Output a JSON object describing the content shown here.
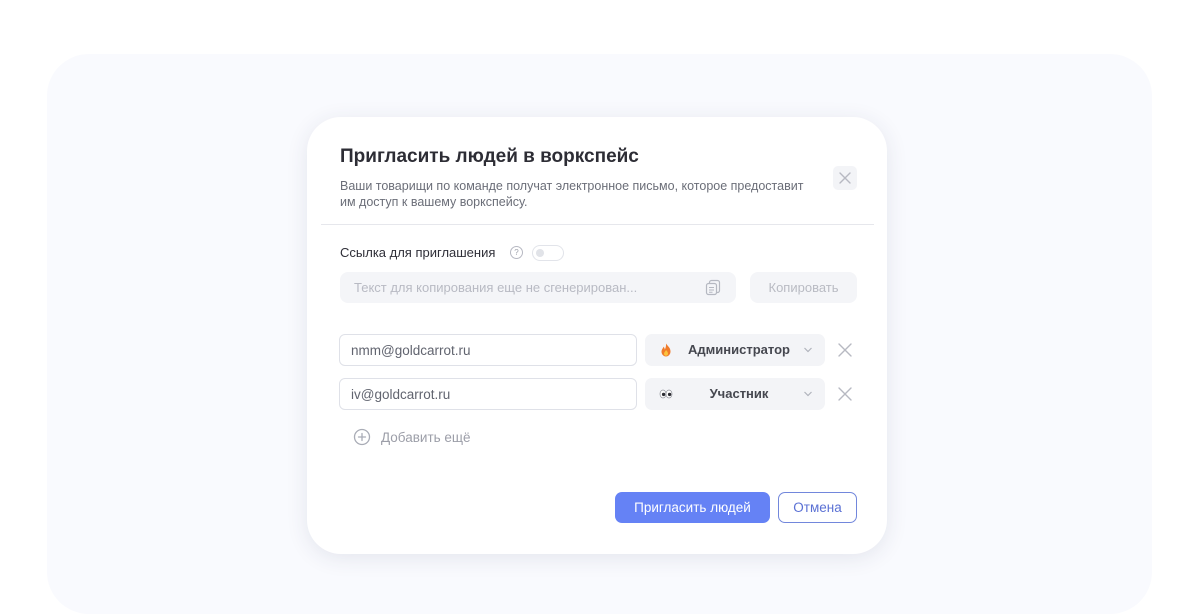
{
  "modal": {
    "title": "Пригласить людей в воркспейс",
    "subtitle": "Ваши товарищи по команде получат электронное письмо, которое предоставит им доступ к вашему воркспейсу."
  },
  "invite_link": {
    "label": "Ссылка для приглашения",
    "help_icon": "?",
    "toggle_on": false,
    "placeholder": "Текст для копирования еще не сгенерирован...",
    "copy_label": "Копировать"
  },
  "invites": [
    {
      "email": "nmm@goldcarrot.ru",
      "role": "Администратор",
      "role_icon": "fire-emoji"
    },
    {
      "email": "iv@goldcarrot.ru",
      "role": "Участник",
      "role_icon": "eyes-emoji"
    }
  ],
  "add_more_label": "Добавить ещё",
  "actions": {
    "invite_label": "Пригласить людей",
    "cancel_label": "Отмена"
  },
  "colors": {
    "primary": "#6582f5",
    "backdrop": "#f9fafe",
    "field_bg": "#f4f5f8"
  }
}
